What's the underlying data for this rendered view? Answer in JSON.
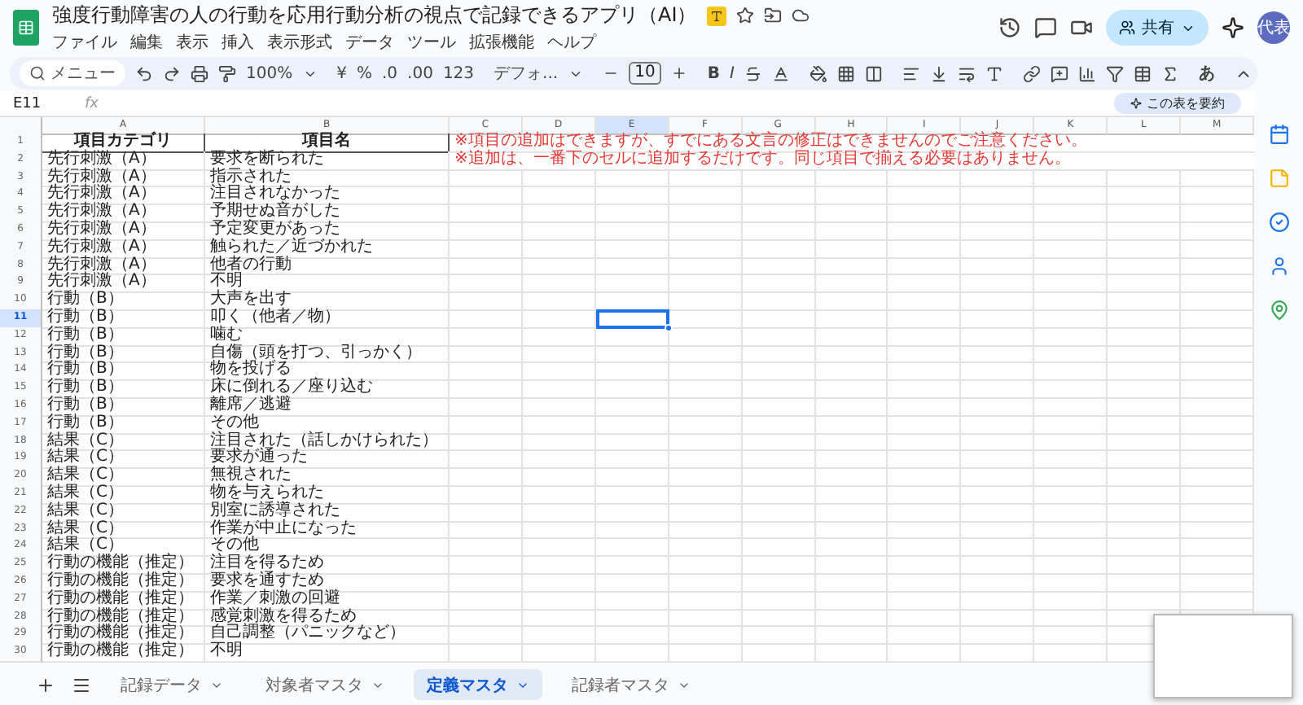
{
  "document": {
    "title": "強度行動障害の人の行動を応用行動分析の視点で記録できるアプリ（AI）",
    "menu": [
      "ファイル",
      "編集",
      "表示",
      "挿入",
      "表示形式",
      "データ",
      "ツール",
      "拡張機能",
      "ヘルプ"
    ]
  },
  "header": {
    "share_label": "共有",
    "avatar": "代表"
  },
  "toolbar": {
    "search_placeholder": "メニュー",
    "zoom": "100%",
    "currency": "¥",
    "percent": "%",
    "decimal_decrease": ".0",
    "decimal_increase": ".00",
    "number_format": "123",
    "font": "デフォ...",
    "font_size": "10",
    "bold": "B",
    "italic": "I",
    "input_tool": "あ"
  },
  "formula_bar": {
    "cell_ref": "E11",
    "fx": "fx",
    "summarize_label": "この表を要約"
  },
  "columns": [
    {
      "label": "A",
      "selected": false
    },
    {
      "label": "B",
      "selected": false
    },
    {
      "label": "C",
      "selected": false
    },
    {
      "label": "D",
      "selected": false
    },
    {
      "label": "E",
      "selected": true
    },
    {
      "label": "F",
      "selected": false
    },
    {
      "label": "G",
      "selected": false
    },
    {
      "label": "H",
      "selected": false
    },
    {
      "label": "I",
      "selected": false
    },
    {
      "label": "J",
      "selected": false
    },
    {
      "label": "K",
      "selected": false
    },
    {
      "label": "L",
      "selected": false
    },
    {
      "label": "M",
      "selected": false
    }
  ],
  "rows": [
    {
      "number": "1",
      "kind": "header",
      "selected": false,
      "cells": [
        "項目カテゴリ",
        "項目名"
      ],
      "note": "※項目の追加はできますが、すでにある文言の修正はできませんのでご注意ください。"
    },
    {
      "number": "2",
      "kind": "data",
      "selected": false,
      "cells": [
        "先行刺激（A）",
        "要求を断られた"
      ],
      "note": "※追加は、一番下のセルに追加するだけです。同じ項目で揃える必要はありません。"
    },
    {
      "number": "3",
      "kind": "data",
      "selected": false,
      "cells": [
        "先行刺激（A）",
        "指示された"
      ]
    },
    {
      "number": "4",
      "kind": "data",
      "selected": false,
      "cells": [
        "先行刺激（A）",
        "注目されなかった"
      ]
    },
    {
      "number": "5",
      "kind": "data",
      "selected": false,
      "cells": [
        "先行刺激（A）",
        "予期せぬ音がした"
      ]
    },
    {
      "number": "6",
      "kind": "data",
      "selected": false,
      "cells": [
        "先行刺激（A）",
        "予定変更があった"
      ]
    },
    {
      "number": "7",
      "kind": "data",
      "selected": false,
      "cells": [
        "先行刺激（A）",
        "触られた／近づかれた"
      ]
    },
    {
      "number": "8",
      "kind": "data",
      "selected": false,
      "cells": [
        "先行刺激（A）",
        "他者の行動"
      ]
    },
    {
      "number": "9",
      "kind": "data",
      "selected": false,
      "cells": [
        "先行刺激（A）",
        "不明"
      ]
    },
    {
      "number": "10",
      "kind": "data",
      "selected": false,
      "cells": [
        "行動（B）",
        "大声を出す"
      ]
    },
    {
      "number": "11",
      "kind": "data",
      "selected": true,
      "cells": [
        "行動（B）",
        "叩く（他者／物）"
      ]
    },
    {
      "number": "12",
      "kind": "data",
      "selected": false,
      "cells": [
        "行動（B）",
        "噛む"
      ]
    },
    {
      "number": "13",
      "kind": "data",
      "selected": false,
      "cells": [
        "行動（B）",
        "自傷（頭を打つ、引っかく）"
      ]
    },
    {
      "number": "14",
      "kind": "data",
      "selected": false,
      "cells": [
        "行動（B）",
        "物を投げる"
      ]
    },
    {
      "number": "15",
      "kind": "data",
      "selected": false,
      "cells": [
        "行動（B）",
        "床に倒れる／座り込む"
      ]
    },
    {
      "number": "16",
      "kind": "data",
      "selected": false,
      "cells": [
        "行動（B）",
        "離席／逃避"
      ]
    },
    {
      "number": "17",
      "kind": "data",
      "selected": false,
      "cells": [
        "行動（B）",
        "その他"
      ]
    },
    {
      "number": "18",
      "kind": "data",
      "selected": false,
      "cells": [
        "結果（C）",
        "注目された（話しかけられた）"
      ]
    },
    {
      "number": "19",
      "kind": "data",
      "selected": false,
      "cells": [
        "結果（C）",
        "要求が通った"
      ]
    },
    {
      "number": "20",
      "kind": "data",
      "selected": false,
      "cells": [
        "結果（C）",
        "無視された"
      ]
    },
    {
      "number": "21",
      "kind": "data",
      "selected": false,
      "cells": [
        "結果（C）",
        "物を与えられた"
      ]
    },
    {
      "number": "22",
      "kind": "data",
      "selected": false,
      "cells": [
        "結果（C）",
        "別室に誘導された"
      ]
    },
    {
      "number": "23",
      "kind": "data",
      "selected": false,
      "cells": [
        "結果（C）",
        "作業が中止になった"
      ]
    },
    {
      "number": "24",
      "kind": "data",
      "selected": false,
      "cells": [
        "結果（C）",
        "その他"
      ]
    },
    {
      "number": "25",
      "kind": "data",
      "selected": false,
      "cells": [
        "行動の機能（推定）",
        "注目を得るため"
      ]
    },
    {
      "number": "26",
      "kind": "data",
      "selected": false,
      "cells": [
        "行動の機能（推定）",
        "要求を通すため"
      ]
    },
    {
      "number": "27",
      "kind": "data",
      "selected": false,
      "cells": [
        "行動の機能（推定）",
        "作業／刺激の回避"
      ]
    },
    {
      "number": "28",
      "kind": "data",
      "selected": false,
      "cells": [
        "行動の機能（推定）",
        "感覚刺激を得るため"
      ]
    },
    {
      "number": "29",
      "kind": "data",
      "selected": false,
      "cells": [
        "行動の機能（推定）",
        "自己調整（パニックなど）"
      ]
    },
    {
      "number": "30",
      "kind": "data",
      "selected": false,
      "cells": [
        "行動の機能（推定）",
        "不明"
      ]
    }
  ],
  "sheet_tabs": [
    {
      "label": "記録データ",
      "selected": false
    },
    {
      "label": "対象者マスタ",
      "selected": false
    },
    {
      "label": "定義マスタ",
      "selected": true
    },
    {
      "label": "記録者マスタ",
      "selected": false
    }
  ]
}
